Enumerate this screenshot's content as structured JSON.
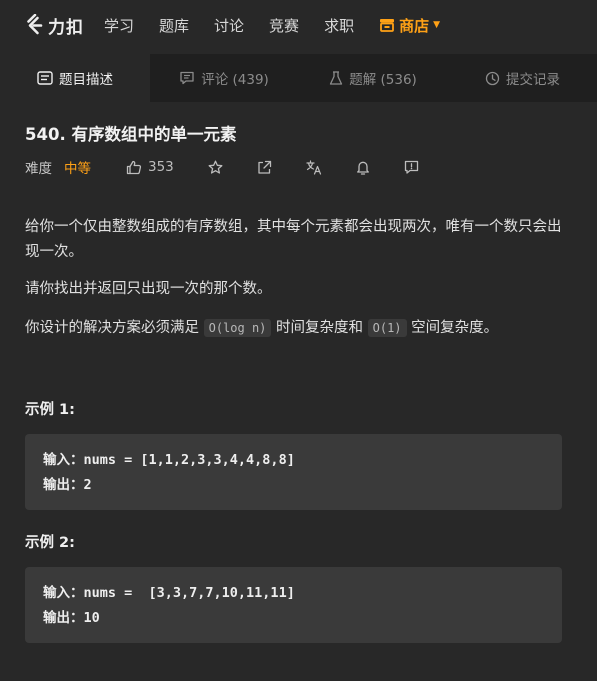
{
  "nav": {
    "logo_text": "力扣",
    "items": [
      "学习",
      "题库",
      "讨论",
      "竞赛",
      "求职"
    ],
    "store_label": "商店",
    "accent_color": "#ffa116"
  },
  "tabs": [
    {
      "label": "题目描述",
      "icon": "description-icon",
      "active": true
    },
    {
      "label": "评论 (439)",
      "icon": "comment-icon",
      "active": false
    },
    {
      "label": "题解 (536)",
      "icon": "flask-icon",
      "active": false
    },
    {
      "label": "提交记录",
      "icon": "history-icon",
      "active": false
    }
  ],
  "problem": {
    "title": "540. 有序数组中的单一元素",
    "difficulty_label": "难度",
    "difficulty": "中等",
    "likes": "353",
    "description": {
      "p1": "给你一个仅由整数组成的有序数组，其中每个元素都会出现两次，唯有一个数只会出现一次。",
      "p2": "请你找出并返回只出现一次的那个数。",
      "p3_prefix": "你设计的解决方案必须满足 ",
      "p3_code1": "O(log n)",
      "p3_mid": " 时间复杂度和 ",
      "p3_code2": "O(1)",
      "p3_suffix": " 空间复杂度。"
    },
    "examples": [
      {
        "title": "示例 1:",
        "input_label": "输入：",
        "input": "nums = [1,1,2,3,3,4,4,8,8]",
        "output_label": "输出：",
        "output": "2"
      },
      {
        "title": "示例 2:",
        "input_label": "输入：",
        "input": "nums =  [3,3,7,7,10,11,11]",
        "output_label": "输出：",
        "output": "10"
      }
    ]
  }
}
